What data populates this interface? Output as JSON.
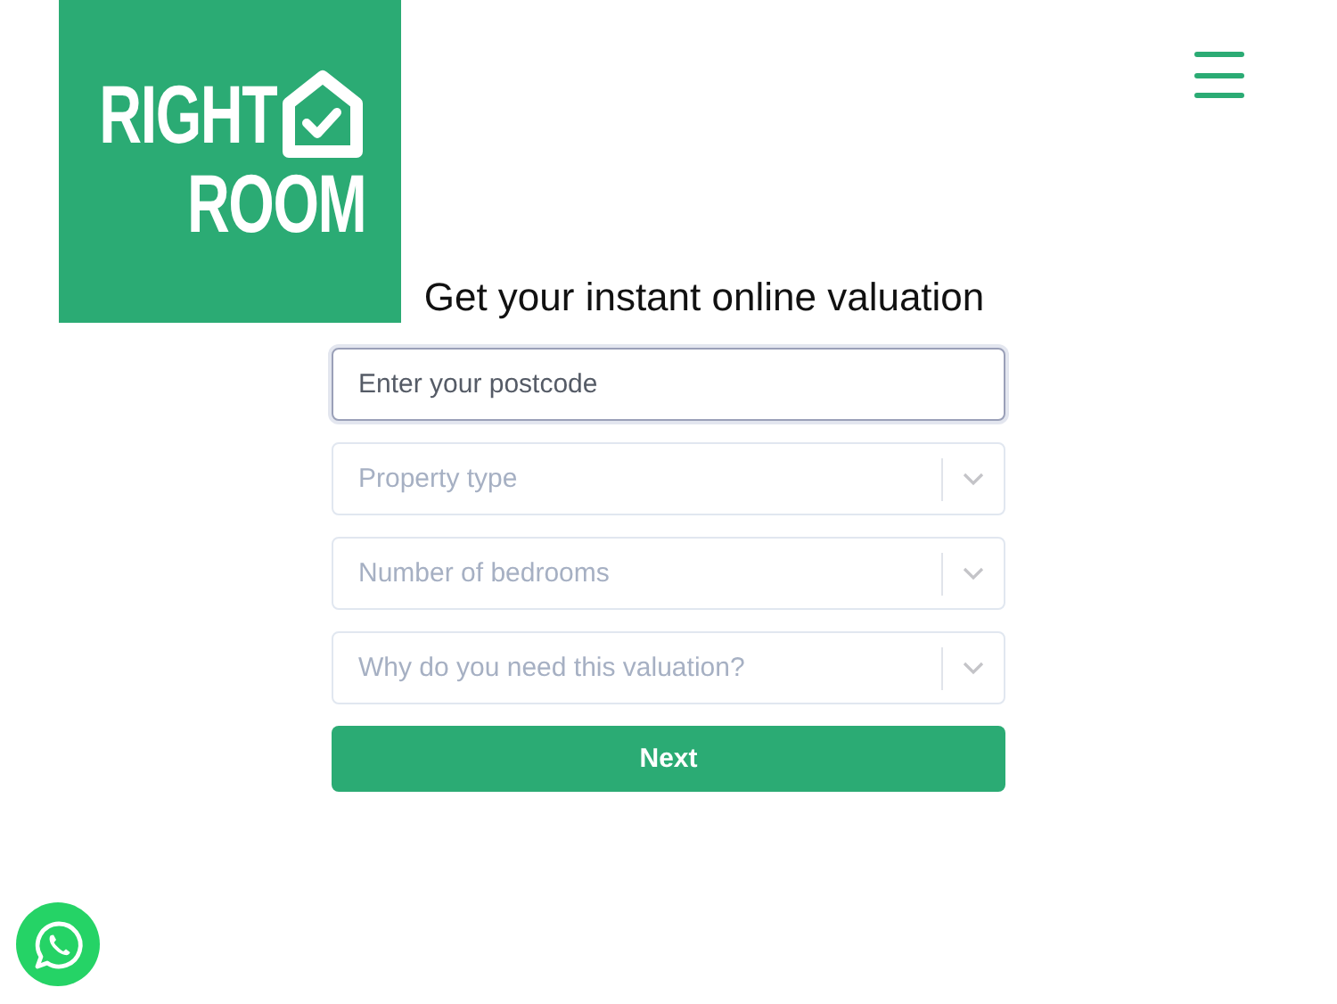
{
  "logo": {
    "lines": [
      "RIGHT",
      "ROOM"
    ]
  },
  "heading": "Get your instant online valuation",
  "postcode": {
    "placeholder": "Enter your postcode",
    "focused": true
  },
  "selects": [
    {
      "placeholder": "Property type"
    },
    {
      "placeholder": "Number of bedrooms"
    },
    {
      "placeholder": "Why do you need this valuation?"
    }
  ],
  "button": "Next"
}
